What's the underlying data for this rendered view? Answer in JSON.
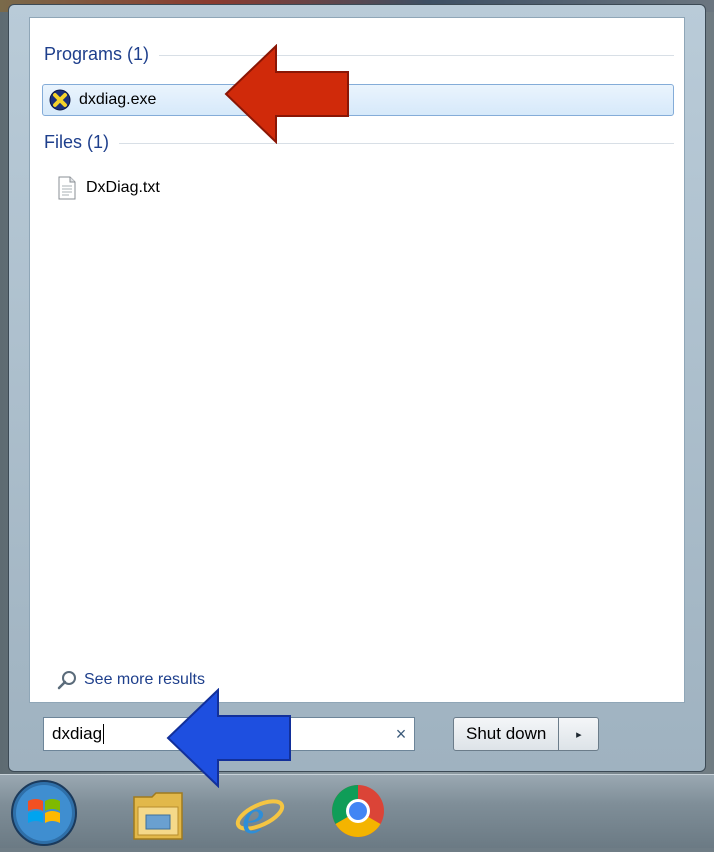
{
  "results": {
    "groups": [
      {
        "label": "Programs (1)"
      },
      {
        "label": "Files (1)"
      }
    ],
    "programs": [
      {
        "label": "dxdiag.exe",
        "icon": "directx-icon"
      }
    ],
    "files": [
      {
        "label": "DxDiag.txt",
        "icon": "text-file-icon"
      }
    ],
    "see_more": "See more results"
  },
  "search": {
    "value": "dxdiag",
    "clear_glyph": "×"
  },
  "power": {
    "shutdown_label": "Shut down",
    "arrow_glyph": "▸"
  },
  "taskbar": {
    "items": [
      {
        "icon": "start-orb-icon"
      },
      {
        "icon": "file-explorer-icon"
      },
      {
        "icon": "internet-explorer-icon"
      },
      {
        "icon": "chrome-icon"
      }
    ]
  },
  "colors": {
    "header_text": "#1e3f8c",
    "selection_fill": "#d6e9fa",
    "red_arrow": "#d02a0a",
    "blue_arrow": "#1e4fe0"
  }
}
